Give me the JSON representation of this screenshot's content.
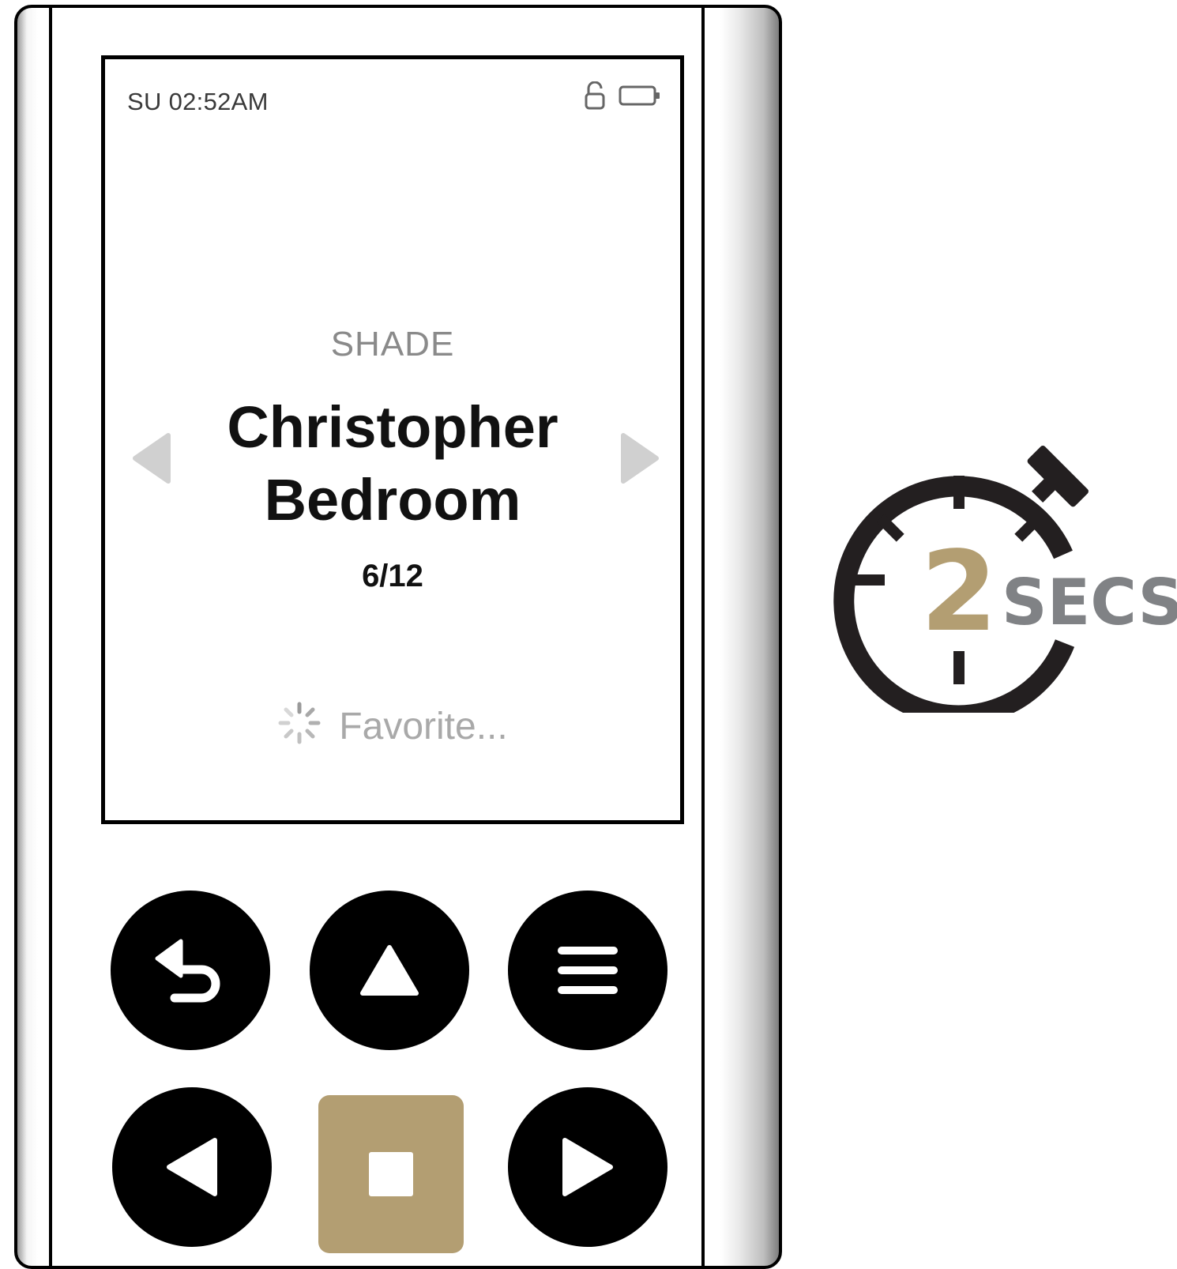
{
  "status_bar": {
    "time": "SU 02:52AM",
    "lock_icon": "unlocked-padlock-icon",
    "battery_icon": "battery-icon"
  },
  "screen": {
    "device_type": "SHADE",
    "device_name_line1": "Christopher",
    "device_name_line2": "Bedroom",
    "page_indicator": "6/12",
    "favorite_label": "Favorite...",
    "nav_prev_icon": "chevron-left-icon",
    "nav_next_icon": "chevron-right-icon",
    "spinner_icon": "loading-spinner-icon"
  },
  "buttons": {
    "row1": [
      "back-icon",
      "up-arrow-icon",
      "menu-icon"
    ],
    "row2": [
      "left-arrow-icon",
      "stop-icon",
      "right-arrow-icon"
    ]
  },
  "timer_badge": {
    "number": "2",
    "unit": "SECS",
    "icon": "stopwatch-icon"
  },
  "colors": {
    "accent_gold": "#b39e72",
    "unit_gray": "#808285",
    "stopwatch_dark": "#231f20"
  }
}
